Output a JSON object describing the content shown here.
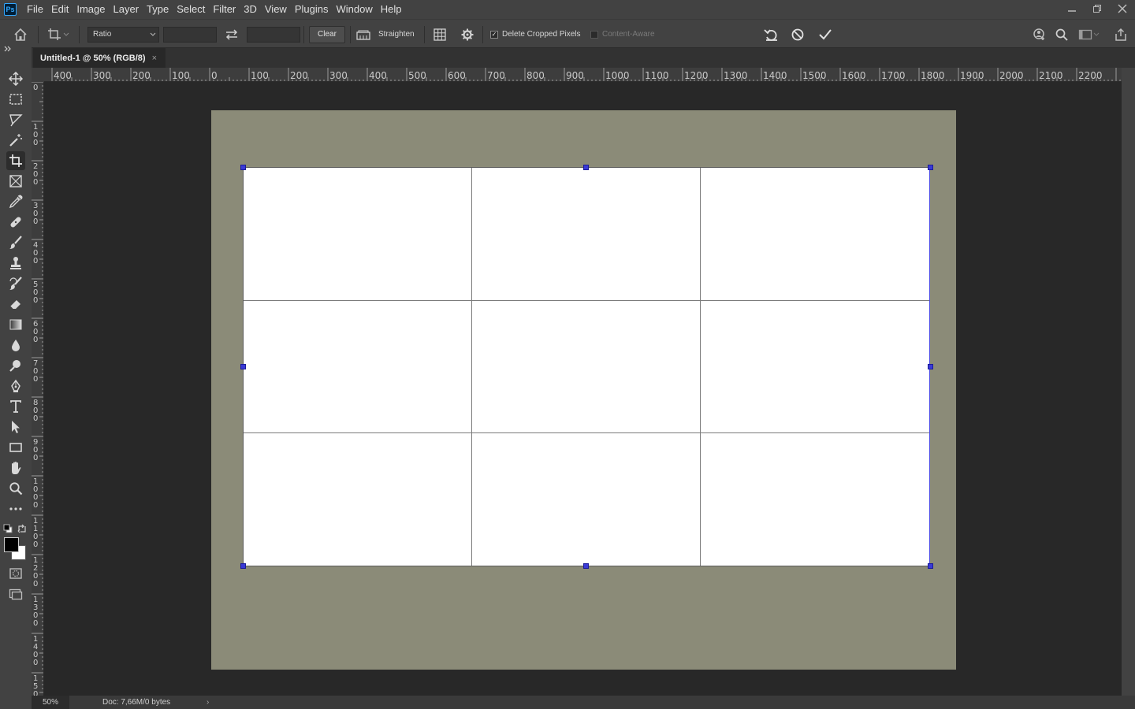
{
  "app": {
    "logo_text": "Ps"
  },
  "menu": [
    "File",
    "Edit",
    "Image",
    "Layer",
    "Type",
    "Select",
    "Filter",
    "3D",
    "View",
    "Plugins",
    "Window",
    "Help"
  ],
  "options_bar": {
    "ratio_select": "Ratio",
    "width_value": "",
    "height_value": "",
    "clear_label": "Clear",
    "straighten_label": "Straighten",
    "delete_cropped_label": "Delete Cropped Pixels",
    "delete_cropped_checked": true,
    "content_aware_label": "Content-Aware",
    "content_aware_checked": false
  },
  "document_tab": {
    "title": "Untitled-1 @ 50% (RGB/8)",
    "close_glyph": "×"
  },
  "rulers": {
    "horizontal": [
      "400",
      "300",
      "200",
      "100",
      "0",
      "100",
      "200",
      "300",
      "400",
      "500",
      "600",
      "700",
      "800",
      "900",
      "1000",
      "1100",
      "1200",
      "1300",
      "1400",
      "1500",
      "1600",
      "1700",
      "1800",
      "1900",
      "2000",
      "2100",
      "2200"
    ],
    "vertical": [
      "0",
      "100",
      "200",
      "300",
      "400",
      "500",
      "600",
      "700",
      "800",
      "900",
      "1000",
      "1100",
      "1200",
      "1300",
      "1400",
      "1500"
    ]
  },
  "tools": [
    "move-tool",
    "rectangular-marquee-tool",
    "lasso-tool",
    "magic-wand-tool",
    "crop-tool",
    "frame-tool",
    "eyedropper-tool",
    "healing-brush-tool",
    "brush-tool",
    "clone-stamp-tool",
    "history-brush-tool",
    "eraser-tool",
    "gradient-tool",
    "blur-tool",
    "dodge-tool",
    "pen-tool",
    "type-tool",
    "path-selection-tool",
    "rectangle-tool",
    "hand-tool",
    "zoom-tool",
    "edit-toolbar"
  ],
  "active_tool": "crop-tool",
  "colors": {
    "foreground": "#000000",
    "background": "#ffffff",
    "canvas_backdrop": "#8b8b78",
    "crop_handle": "#3a3ad6"
  },
  "status": {
    "zoom": "50%",
    "doc_info": "Doc: 7,66M/0 bytes",
    "arrow": "›"
  }
}
